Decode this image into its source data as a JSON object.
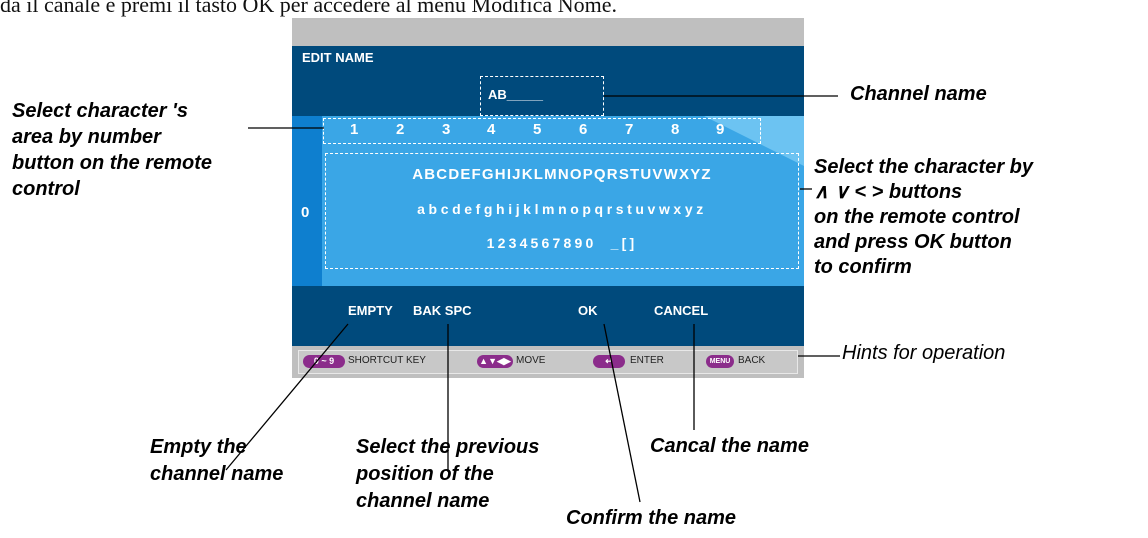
{
  "top_caption": "da il canale e premi il tasto OK per accedere al menu Modifica Nome.",
  "screen": {
    "title": "EDIT NAME",
    "channel_name_value": "AB_____",
    "number_row": [
      "1",
      "2",
      "3",
      "4",
      "5",
      "6",
      "7",
      "8",
      "9"
    ],
    "zero_key": "0",
    "char_rows": [
      "ABCDEFGHIJKLMNOPQRSTUVWXYZ",
      "abcdefghijklmnopqrstuvwxyz",
      "1234567890  _[]"
    ],
    "buttons": {
      "empty": "EMPTY",
      "bak_spc": "BAK SPC",
      "ok": "OK",
      "cancel": "CANCEL"
    },
    "hints": [
      {
        "key": "0 ~ 9",
        "label": "SHORTCUT KEY"
      },
      {
        "key": "▲▼◀▶",
        "label": "MOVE"
      },
      {
        "key": "↵",
        "label": "ENTER"
      },
      {
        "key": "MENU",
        "label": "BACK"
      }
    ],
    "hint_key_color": "#8b2c8b"
  },
  "annotations": {
    "channel_name": "Channel name",
    "select_area": "Select character 's\narea by number\nbutton on the remote\ncontrol",
    "select_char": "Select the character by\n∧  ∨  <  >  buttons\non the remote control\nand press OK button\nto confirm",
    "hints": "Hints for operation",
    "empty": "Empty the\nchannel name",
    "previous": "Select the previous\nposition of the\nchannel name",
    "cancel": "Cancal the name",
    "confirm": "Confirm the name"
  }
}
